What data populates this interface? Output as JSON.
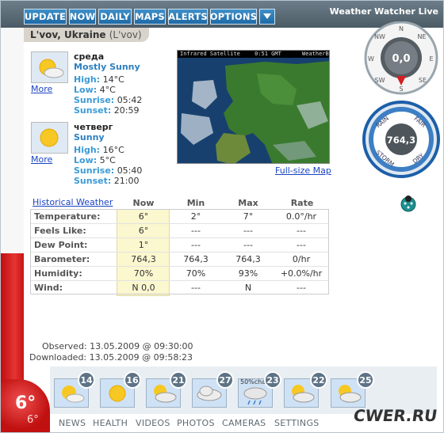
{
  "app_title": "Weather Watcher Live",
  "toolbar": {
    "update": "UPDATE",
    "now": "NOW",
    "daily": "DAILY",
    "maps": "MAPS",
    "alerts": "ALERTS",
    "options": "OPTIONS",
    "dropdown_icon": "chevron-down-icon"
  },
  "location": "L'vov, Ukraine",
  "location_alt": "(L'vov)",
  "forecast": [
    {
      "day": "среда",
      "condition": "Mostly Sunny",
      "icon": "sun-cloud-icon",
      "high_label": "High:",
      "high": "14°C",
      "low_label": "Low:",
      "low": "4°C",
      "sunrise_label": "Sunrise:",
      "sunrise": "05:42",
      "sunset_label": "Sunset:",
      "sunset": "20:59",
      "more": "More"
    },
    {
      "day": "четверг",
      "condition": "Sunny",
      "icon": "sun-icon",
      "high_label": "High:",
      "high": "16°C",
      "low_label": "Low:",
      "low": "5°C",
      "sunrise_label": "Sunrise:",
      "sunrise": "05:40",
      "sunset_label": "Sunset:",
      "sunset": "21:00",
      "more": "More"
    }
  ],
  "map": {
    "caption_left": "Infrared Satellite",
    "caption_time": "0:51 GMT",
    "caption_right": "WeatherBug",
    "fullsize_link": "Full-size Map"
  },
  "compass": {
    "n": "N",
    "ne": "NE",
    "e": "E",
    "se": "SE",
    "s": "S",
    "sw": "SW",
    "w": "W",
    "nw": "NW",
    "value": "0,0"
  },
  "barometer_gauge": {
    "rain": "RAIN",
    "fair": "FAIR",
    "storm": "STORM",
    "dry": "DRY",
    "value": "764,3"
  },
  "table": {
    "history_link": "Historical Weather",
    "headers": [
      "Now",
      "Min",
      "Max",
      "Rate"
    ],
    "rows": [
      {
        "label": "Temperature:",
        "now": "6°",
        "min": "2°",
        "max": "7°",
        "rate": "0.0°/hr"
      },
      {
        "label": "Feels Like:",
        "now": "6°",
        "min": "---",
        "max": "---",
        "rate": "---"
      },
      {
        "label": "Dew Point:",
        "now": "1°",
        "min": "---",
        "max": "---",
        "rate": "---"
      },
      {
        "label": "Barometer:",
        "now": "764,3",
        "min": "764,3",
        "max": "764,3",
        "rate": "0/hr"
      },
      {
        "label": "Humidity:",
        "now": "70%",
        "min": "70%",
        "max": "93%",
        "rate": "+0.0%/hr"
      },
      {
        "label": "Wind:",
        "now": "N 0,0",
        "min": "---",
        "max": "N",
        "rate": "---"
      }
    ]
  },
  "observed_label": "Observed:",
  "observed": "13.05.2009 @ 09:30:00",
  "downloaded_label": "Downloaded:",
  "downloaded": "13.05.2009 @ 09:58:23",
  "current_temp": "6°",
  "current_temp_small": "6°",
  "days": [
    {
      "date": "14",
      "icon": "sun-cloud-icon"
    },
    {
      "date": "16",
      "icon": "sun-icon"
    },
    {
      "date": "21",
      "icon": "sun-cloud-icon"
    },
    {
      "date": "27",
      "icon": "cloud-icon"
    },
    {
      "date": "23",
      "icon": "rain-icon",
      "chance": "50%chance"
    },
    {
      "date": "22",
      "icon": "sun-cloud-icon"
    },
    {
      "date": "25",
      "icon": "sun-cloud-icon"
    }
  ],
  "bottom_nav": [
    "NEWS",
    "HEALTH",
    "VIDEOS",
    "PHOTOS",
    "CAMERAS",
    "SETTINGS"
  ],
  "watermark": "CWER.RU",
  "colors": {
    "toolbar_blue": "#2a7dbb",
    "thermo_red": "#d62020",
    "now_column": "#fbf7cf",
    "link": "#1a44c4"
  }
}
